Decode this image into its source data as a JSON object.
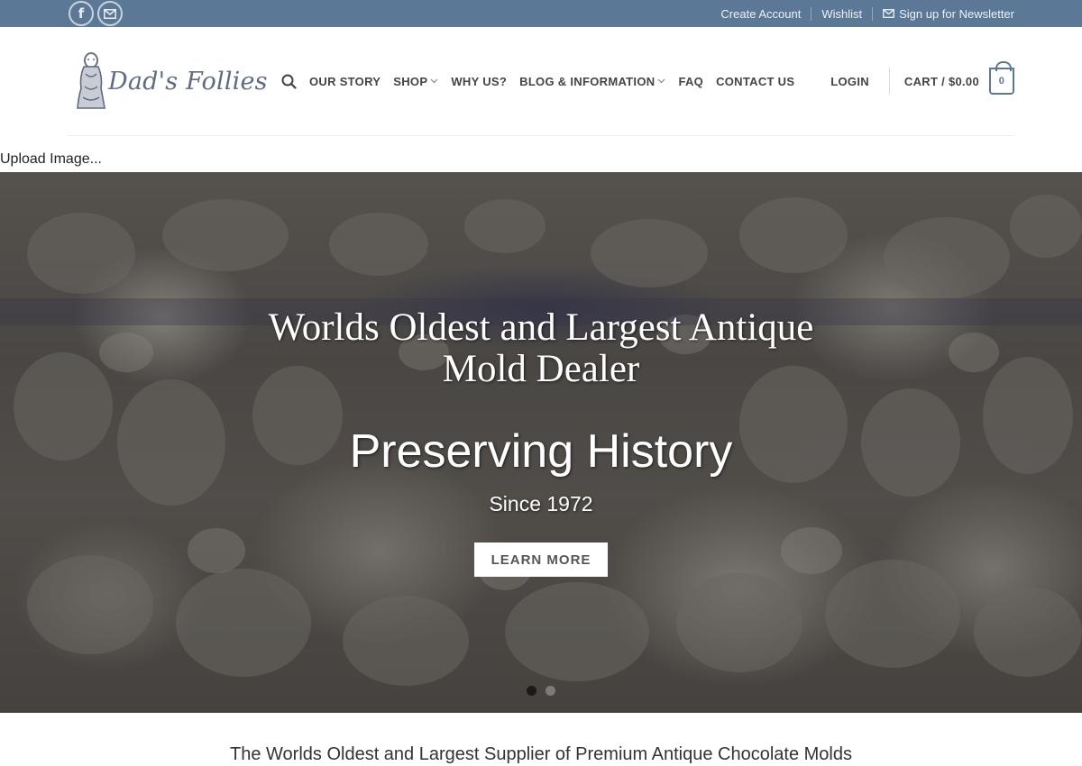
{
  "topbar": {
    "social": [
      {
        "name": "facebook-icon",
        "glyph": "f"
      },
      {
        "name": "email-icon"
      }
    ],
    "links": [
      {
        "label": "Create Account"
      },
      {
        "label": "Wishlist"
      },
      {
        "label": "Sign up for Newsletter",
        "icon": "envelope-icon"
      }
    ],
    "bg_color": "#5b7896"
  },
  "header": {
    "logo_text": "Dad's Follies",
    "nav": [
      {
        "label": "OUR STORY",
        "dropdown": false
      },
      {
        "label": "SHOP",
        "dropdown": true
      },
      {
        "label": "WHY US?",
        "dropdown": false
      },
      {
        "label": "BLOG & INFORMATION",
        "dropdown": true
      },
      {
        "label": "FAQ",
        "dropdown": false
      },
      {
        "label": "CONTACT US",
        "dropdown": false
      }
    ],
    "login_label": "LOGIN",
    "cart_label": "CART / $0.00",
    "cart_count": "0"
  },
  "upload_text": "Upload Image...",
  "hero": {
    "title": "Worlds Oldest and Largest Antique Mold Dealer",
    "heading": "Preserving History",
    "subheading": "Since 1972",
    "button_label": "LEARN MORE",
    "slides_total": 2,
    "slide_active": 1
  },
  "tagline": "The Worlds Oldest and Largest Supplier of Premium Antique Chocolate Molds"
}
